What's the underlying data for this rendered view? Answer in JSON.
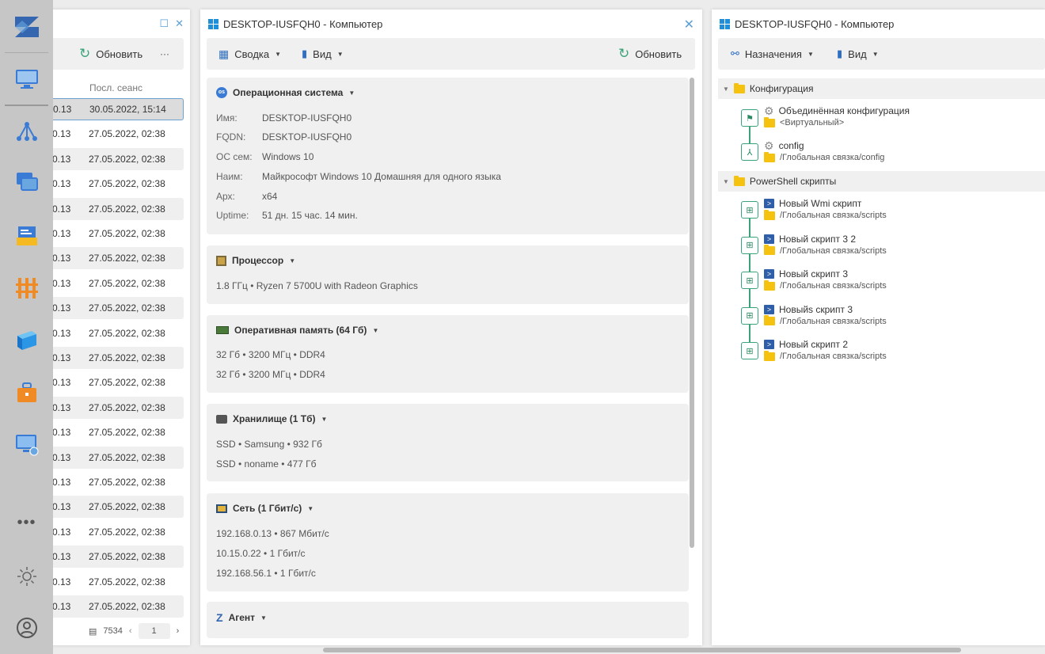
{
  "nav": {
    "items": [
      "logo-icon",
      "monitor-icon",
      "network-icon",
      "windows-icon",
      "inventory-icon",
      "firewall-icon",
      "box-icon",
      "toolbox-icon",
      "remote-desktop-icon",
      "more-icon",
      "settings-icon",
      "user-icon"
    ]
  },
  "list_panel": {
    "refresh_label": "Обновить",
    "more_label": "···",
    "column_header": "Посл. сеанс",
    "rows": [
      {
        "ip": "0.13",
        "last": "30.05.2022, 15:14"
      },
      {
        "ip": "0.13",
        "last": "27.05.2022, 02:38"
      },
      {
        "ip": "0.13",
        "last": "27.05.2022, 02:38"
      },
      {
        "ip": "0.13",
        "last": "27.05.2022, 02:38"
      },
      {
        "ip": "0.13",
        "last": "27.05.2022, 02:38"
      },
      {
        "ip": "0.13",
        "last": "27.05.2022, 02:38"
      },
      {
        "ip": "0.13",
        "last": "27.05.2022, 02:38"
      },
      {
        "ip": "0.13",
        "last": "27.05.2022, 02:38"
      },
      {
        "ip": "0.13",
        "last": "27.05.2022, 02:38"
      },
      {
        "ip": "0.13",
        "last": "27.05.2022, 02:38"
      },
      {
        "ip": "0.13",
        "last": "27.05.2022, 02:38"
      },
      {
        "ip": "0.13",
        "last": "27.05.2022, 02:38"
      },
      {
        "ip": "0.13",
        "last": "27.05.2022, 02:38"
      },
      {
        "ip": "0.13",
        "last": "27.05.2022, 02:38"
      },
      {
        "ip": "0.13",
        "last": "27.05.2022, 02:38"
      },
      {
        "ip": "0.13",
        "last": "27.05.2022, 02:38"
      },
      {
        "ip": "0.13",
        "last": "27.05.2022, 02:38"
      },
      {
        "ip": "0.13",
        "last": "27.05.2022, 02:38"
      },
      {
        "ip": "0.13",
        "last": "27.05.2022, 02:38"
      },
      {
        "ip": "0.13",
        "last": "27.05.2022, 02:38"
      },
      {
        "ip": "0.13",
        "last": "27.05.2022, 02:38"
      }
    ],
    "total": "7534",
    "page": "1"
  },
  "details_panel": {
    "title": "DESKTOP-IUSFQH0 - Компьютер",
    "summary_label": "Сводка",
    "view_label": "Вид",
    "refresh_label": "Обновить",
    "os": {
      "header": "Операционная система",
      "badge": "os",
      "fields": [
        {
          "k": "Имя:",
          "v": "DESKTOP-IUSFQH0"
        },
        {
          "k": "FQDN:",
          "v": "DESKTOP-IUSFQH0"
        },
        {
          "k": "ОС сем:",
          "v": "Windows 10"
        },
        {
          "k": "Наим:",
          "v": "Майкрософт Windows 10 Домашняя для одного языка"
        },
        {
          "k": "Арх:",
          "v": "x64"
        },
        {
          "k": "Uptime:",
          "v": "51 дн. 15 час. 14 мин."
        }
      ]
    },
    "cpu": {
      "header": "Процессор",
      "lines": [
        "1.8 ГГц • Ryzen 7 5700U with Radeon Graphics"
      ]
    },
    "ram": {
      "header": "Оперативная память (64 Гб)",
      "lines": [
        "32 Гб • 3200 МГц • DDR4",
        "32 Гб • 3200 МГц • DDR4"
      ]
    },
    "storage": {
      "header": "Хранилище (1 Тб)",
      "lines": [
        "SSD • Samsung • 932 Гб",
        "SSD • noname • 477 Гб"
      ]
    },
    "net": {
      "header": "Сеть (1 Гбит/с)",
      "lines": [
        "192.168.0.13 • 867 Мбит/с",
        "10.15.0.22 • 1 Гбит/с",
        "192.168.56.1 • 1 Гбит/с"
      ]
    },
    "agent": {
      "header": "Агент"
    }
  },
  "assign_panel": {
    "title": "DESKTOP-IUSFQH0 - Компьютер",
    "assign_label": "Назначения",
    "view_label": "Вид",
    "config_group": "Конфигурация",
    "config_items": [
      {
        "name": "Объединённая конфигурация",
        "path": "<Виртуальный>"
      },
      {
        "name": "config",
        "path": "/Глобальная связка/config"
      }
    ],
    "scripts_group": "PowerShell скрипты",
    "scripts": [
      {
        "name": "Новый Wmi скрипт",
        "path": "/Глобальная связка/scripts"
      },
      {
        "name": "Новый скрипт 3 2",
        "path": "/Глобальная связка/scripts"
      },
      {
        "name": "Новый скрипт 3",
        "path": "/Глобальная связка/scripts"
      },
      {
        "name": "Новыйs скрипт 3",
        "path": "/Глобальная связка/scripts"
      },
      {
        "name": "Новый скрипт 2",
        "path": "/Глобальная связка/scripts"
      }
    ]
  },
  "colors": {
    "accent": "#5b9fd6",
    "tree_line": "#3aa37a",
    "folder": "#f5c210",
    "card_bg": "#f0f0f0"
  }
}
